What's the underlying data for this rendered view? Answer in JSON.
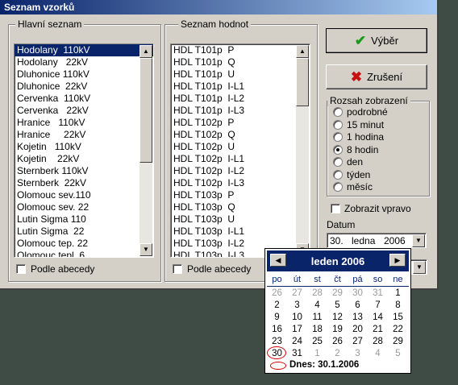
{
  "window": {
    "title": "Seznam vzorků"
  },
  "main_list": {
    "label": "Hlavní seznam",
    "items": [
      "Hodolany  110kV",
      "Hodolany   22kV",
      "Dluhonice 110kV",
      "Dluhonice  22kV",
      "Cervenka  110kV",
      "Cervenka   22kV",
      "Hranice   110kV",
      "Hranice     22kV",
      "Kojetin   110kV",
      "Kojetin    22kV",
      "Sternberk 110kV",
      "Sternberk  22kV",
      "Olomouc sev.110",
      "Olomouc sev. 22",
      "Lutin Sigma 110",
      "Lutin Sigma  22",
      "Olomouc tep. 22",
      "Olomouc tepl. 6"
    ],
    "selected_index": 0,
    "sort_label": "Podle abecedy"
  },
  "value_list": {
    "label": "Seznam hodnot",
    "items": [
      "HDL T101p  P",
      "HDL T101p  Q",
      "HDL T101p  U",
      "HDL T101p  I-L1",
      "HDL T101p  I-L2",
      "HDL T101p  I-L3",
      "HDL T102p  P",
      "HDL T102p  Q",
      "HDL T102p  U",
      "HDL T102p  I-L1",
      "HDL T102p  I-L2",
      "HDL T102p  I-L3",
      "HDL T103p  P",
      "HDL T103p  Q",
      "HDL T103p  U",
      "HDL T103p  I-L1",
      "HDL T103p  I-L2",
      "HDL T103p  I-L3"
    ],
    "sort_label": "Podle abecedy"
  },
  "buttons": {
    "ok": "Výběr",
    "cancel": "Zrušení"
  },
  "range": {
    "label": "Rozsah zobrazení",
    "options": [
      "podrobné",
      "15 minut",
      "1 hodina",
      "8 hodin",
      "den",
      "týden",
      "měsíc"
    ],
    "selected_index": 3
  },
  "show_right_label": "Zobrazit vpravo",
  "date": {
    "label": "Datum",
    "day": "30.",
    "month": "ledna",
    "year": "2006"
  },
  "calendar": {
    "month_label": "leden 2006",
    "weekdays": [
      "po",
      "út",
      "st",
      "čt",
      "pá",
      "so",
      "ne"
    ],
    "weeks": [
      [
        "26",
        "27",
        "28",
        "29",
        "30",
        "31",
        "1"
      ],
      [
        "2",
        "3",
        "4",
        "5",
        "6",
        "7",
        "8"
      ],
      [
        "9",
        "10",
        "11",
        "12",
        "13",
        "14",
        "15"
      ],
      [
        "16",
        "17",
        "18",
        "19",
        "20",
        "21",
        "22"
      ],
      [
        "23",
        "24",
        "25",
        "26",
        "27",
        "28",
        "29"
      ],
      [
        "30",
        "31",
        "1",
        "2",
        "3",
        "4",
        "5"
      ]
    ],
    "today_label": "Dnes: 30.1.2006",
    "colors": {
      "header": "#0a246a",
      "today_ring": "#d00000"
    }
  }
}
